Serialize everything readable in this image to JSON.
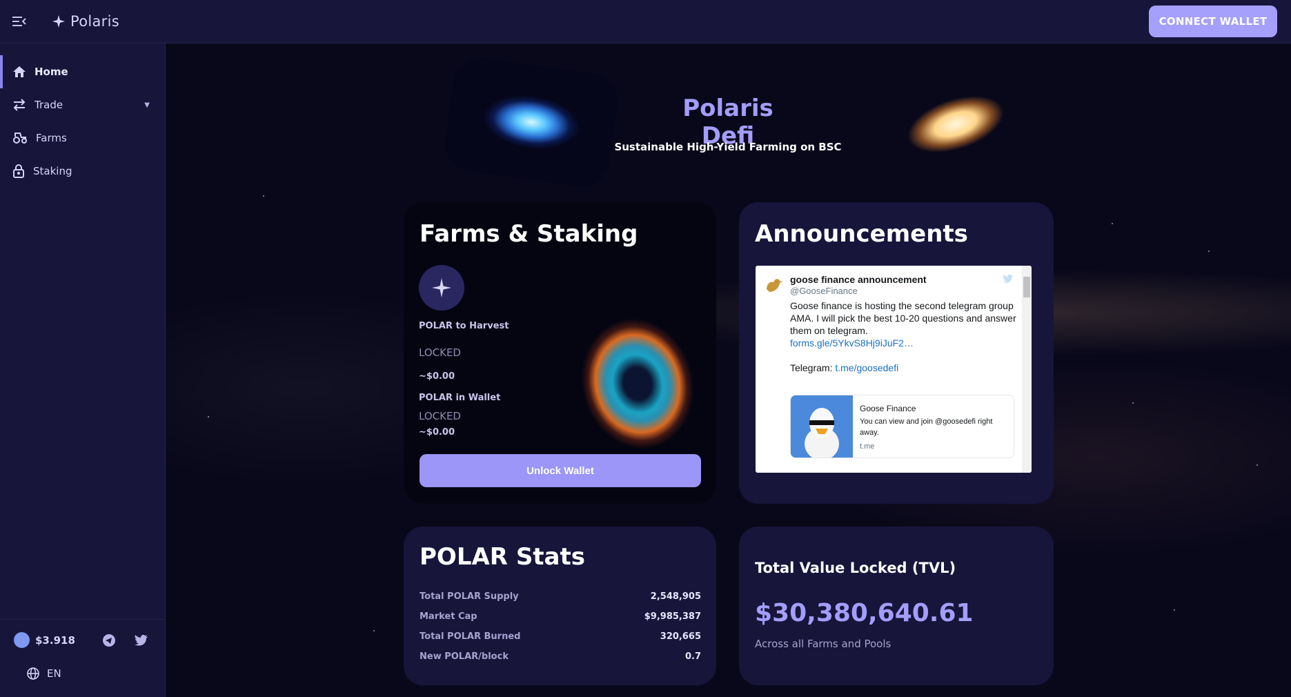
{
  "header": {
    "logo_text": "Polaris",
    "connect_label": "CONNECT WALLET"
  },
  "sidebar": {
    "items": [
      {
        "label": "Home",
        "icon": "home-icon"
      },
      {
        "label": "Trade",
        "icon": "swap-icon"
      },
      {
        "label": "Farms",
        "icon": "tractor-icon"
      },
      {
        "label": "Staking",
        "icon": "lock-icon"
      }
    ],
    "price": "$3.918",
    "language": "EN"
  },
  "hero": {
    "title": "Polaris Defi",
    "subtitle": "Sustainable High-Yield Farming on BSC"
  },
  "farms": {
    "title": "Farms & Staking",
    "harvest_label": "POLAR to Harvest",
    "harvest_value": "LOCKED",
    "harvest_usd": "~$0.00",
    "wallet_label": "POLAR in Wallet",
    "wallet_value": "LOCKED",
    "wallet_usd": "~$0.00",
    "unlock_label": "Unlock Wallet"
  },
  "announcements": {
    "title": "Announcements",
    "tweet": {
      "name": "goose finance announcement",
      "handle": "@GooseFinance",
      "text_line": "Goose finance is hosting the second telegram group AMA. I will pick the best 10-20 questions and answer them on telegram.",
      "link": "forms.gle/5YkvS8Hj9iJuF2…",
      "telegram_label": "Telegram:",
      "telegram_link": "t.me/goosedefi",
      "card_title": "Goose Finance",
      "card_desc": "You can view and join @goosedefi right away.",
      "card_url": "t.me"
    }
  },
  "stats": {
    "title": "POLAR Stats",
    "rows": [
      {
        "label": "Total POLAR Supply",
        "value": "2,548,905"
      },
      {
        "label": "Market Cap",
        "value": "$9,985,387"
      },
      {
        "label": "Total POLAR Burned",
        "value": "320,665"
      },
      {
        "label": "New POLAR/block",
        "value": "0.7"
      }
    ]
  },
  "tvl": {
    "title": "Total Value Locked (TVL)",
    "value": "$30,380,640.61",
    "subtitle": "Across all Farms and Pools"
  },
  "colors": {
    "accent": "#a39dfb",
    "button": "#9b96f7",
    "panel": "#17153a"
  }
}
